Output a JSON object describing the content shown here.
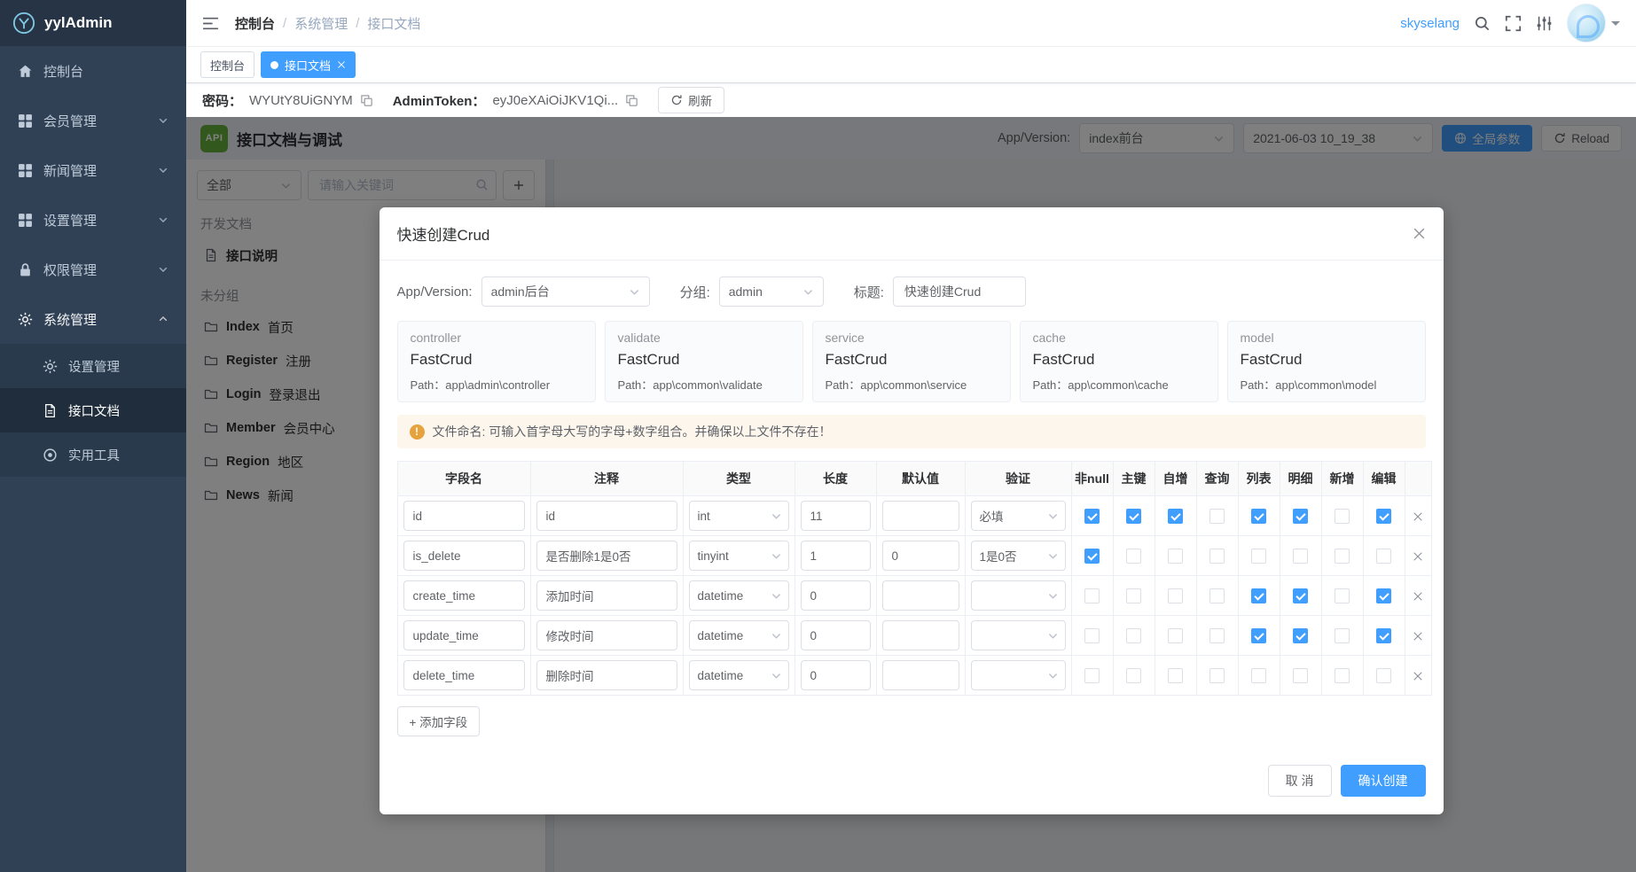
{
  "app": {
    "logo_text": "yylAdmin",
    "accent_color": "#409eff",
    "sidebar_color": "#304156"
  },
  "sidebar": {
    "items": [
      {
        "key": "dashboard",
        "label": "控制台",
        "icon": "home-icon",
        "expandable": false
      },
      {
        "key": "member",
        "label": "会员管理",
        "icon": "grid-icon",
        "expandable": true
      },
      {
        "key": "news",
        "label": "新闻管理",
        "icon": "grid-icon",
        "expandable": true
      },
      {
        "key": "setting",
        "label": "设置管理",
        "icon": "grid-icon",
        "expandable": true
      },
      {
        "key": "auth",
        "label": "权限管理",
        "icon": "lock-icon",
        "expandable": true
      },
      {
        "key": "system",
        "label": "系统管理",
        "icon": "gear-icon",
        "expandable": true,
        "expanded": true,
        "children": [
          {
            "key": "system-setting",
            "label": "设置管理",
            "icon": "gear-icon",
            "active": false
          },
          {
            "key": "api-doc",
            "label": "接口文档",
            "icon": "document-icon",
            "active": true
          },
          {
            "key": "tools",
            "label": "实用工具",
            "icon": "tool-icon",
            "active": false
          }
        ]
      }
    ]
  },
  "topbar": {
    "breadcrumb": [
      "控制台",
      "系统管理",
      "接口文档"
    ],
    "username": "skyselang"
  },
  "tabs": [
    {
      "key": "console",
      "label": "控制台",
      "active": false,
      "closable": false
    },
    {
      "key": "api-doc",
      "label": "接口文档",
      "active": true,
      "closable": true
    }
  ],
  "token_row": {
    "password_label": "密码：",
    "password_value": "WYUtY8UiGNYM",
    "token_label": "AdminToken：",
    "token_value": "eyJ0eXAiOiJKV1Qi...",
    "refresh_label": "刷新"
  },
  "content_header": {
    "api_badge": "API",
    "title": "接口文档与调试",
    "app_version_label": "App/Version:",
    "app_version_value": "index前台",
    "date_value": "2021-06-03 10_19_38",
    "global_params_label": "全局参数",
    "reload_label": "Reload"
  },
  "left_panel": {
    "filter_value": "全部",
    "search_placeholder": "请输入关键词",
    "tree": [
      {
        "type": "section",
        "label": "开发文档"
      },
      {
        "type": "doc",
        "label": "接口说明"
      },
      {
        "type": "section",
        "label": "未分组"
      },
      {
        "type": "folder",
        "name": "Index",
        "desc": "首页"
      },
      {
        "type": "folder",
        "name": "Register",
        "desc": "注册"
      },
      {
        "type": "folder",
        "name": "Login",
        "desc": "登录退出"
      },
      {
        "type": "folder",
        "name": "Member",
        "desc": "会员中心"
      },
      {
        "type": "folder",
        "name": "Region",
        "desc": "地区"
      },
      {
        "type": "folder",
        "name": "News",
        "desc": "新闻"
      }
    ]
  },
  "modal": {
    "title": "快速创建Crud",
    "form": {
      "app_version_label": "App/Version:",
      "app_version_value": "admin后台",
      "group_label": "分组:",
      "group_value": "admin",
      "title_label": "标题:",
      "title_value": "快速创建Crud"
    },
    "cards": [
      {
        "kind": "controller",
        "name": "FastCrud",
        "path": "Path：app\\admin\\controller"
      },
      {
        "kind": "validate",
        "name": "FastCrud",
        "path": "Path：app\\common\\validate"
      },
      {
        "kind": "service",
        "name": "FastCrud",
        "path": "Path：app\\common\\service"
      },
      {
        "kind": "cache",
        "name": "FastCrud",
        "path": "Path：app\\common\\cache"
      },
      {
        "kind": "model",
        "name": "FastCrud",
        "path": "Path：app\\common\\model"
      }
    ],
    "warning": "文件命名: 可输入首字母大写的字母+数字组合。并确保以上文件不存在！",
    "table": {
      "headers": [
        "字段名",
        "注释",
        "类型",
        "长度",
        "默认值",
        "验证",
        "非null",
        "主键",
        "自增",
        "查询",
        "列表",
        "明细",
        "新增",
        "编辑"
      ],
      "check_keys": [
        "not-null",
        "primary-key",
        "auto-increment",
        "query",
        "list",
        "detail",
        "add",
        "edit"
      ],
      "rows": [
        {
          "field": "id",
          "comment": "id",
          "type": "int",
          "length": "11",
          "default": "",
          "validate": "必填",
          "checks": [
            true,
            true,
            true,
            false,
            true,
            true,
            false,
            true
          ]
        },
        {
          "field": "is_delete",
          "comment": "是否删除1是0否",
          "type": "tinyint",
          "length": "1",
          "default": "0",
          "validate": "1是0否",
          "checks": [
            true,
            false,
            false,
            false,
            false,
            false,
            false,
            false
          ]
        },
        {
          "field": "create_time",
          "comment": "添加时间",
          "type": "datetime",
          "length": "0",
          "default": "",
          "validate": "",
          "checks": [
            false,
            false,
            false,
            false,
            true,
            true,
            false,
            true
          ]
        },
        {
          "field": "update_time",
          "comment": "修改时间",
          "type": "datetime",
          "length": "0",
          "default": "",
          "validate": "",
          "checks": [
            false,
            false,
            false,
            false,
            true,
            true,
            false,
            true
          ]
        },
        {
          "field": "delete_time",
          "comment": "删除时间",
          "type": "datetime",
          "length": "0",
          "default": "",
          "validate": "",
          "checks": [
            false,
            false,
            false,
            false,
            false,
            false,
            false,
            false
          ]
        }
      ]
    },
    "add_field_label": "+ 添加字段",
    "cancel_label": "取 消",
    "confirm_label": "确认创建"
  }
}
